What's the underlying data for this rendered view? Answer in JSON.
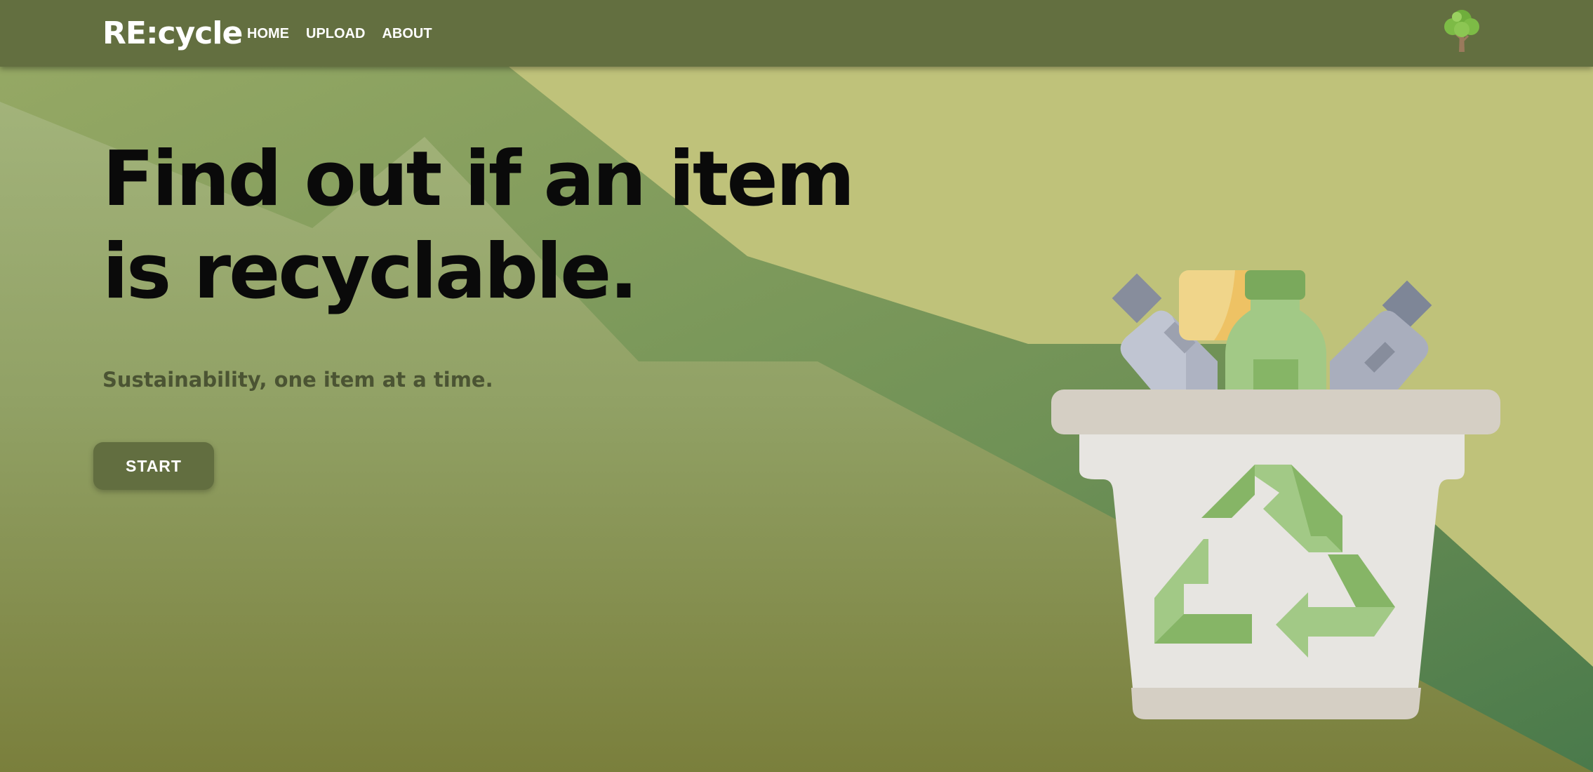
{
  "navbar": {
    "brand": "RE:cycle",
    "links": [
      {
        "label": "HOME"
      },
      {
        "label": "UPLOAD"
      },
      {
        "label": "ABOUT"
      }
    ],
    "corner_icon": "tree-icon"
  },
  "hero": {
    "headline": "Find out if an item is recyclable.",
    "tagline": "Sustainability, one item at a time.",
    "start_label": "START",
    "illustration": "recycling-bin-with-bottles"
  },
  "colors": {
    "navbar": "#636f40",
    "button": "#626e40",
    "background_light": "#bdc27a",
    "background_dark": "#4f7c4c"
  }
}
